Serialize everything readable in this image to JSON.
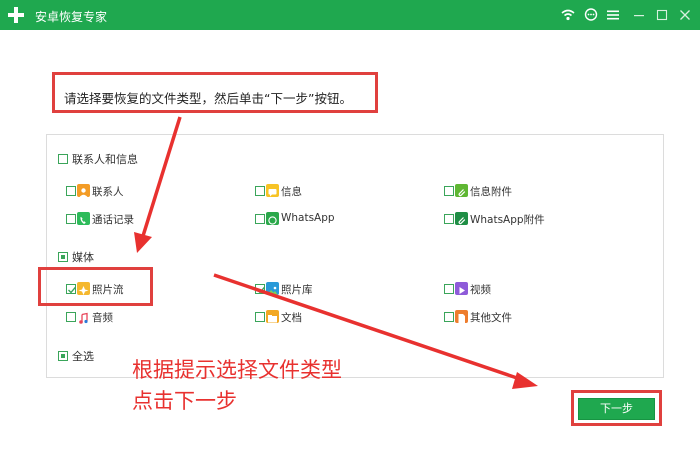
{
  "titlebar": {
    "title": "安卓恢复专家",
    "bg_color": "#1fa84f",
    "icons": [
      "wifi-icon",
      "chat-icon",
      "menu-icon",
      "minimize-icon",
      "maximize-icon",
      "close-icon"
    ]
  },
  "instruction": "请选择要恢复的文件类型，然后单击“下一步”按钮。",
  "groups": {
    "contacts": {
      "label": "联系人和信息",
      "state": "unchecked",
      "items": [
        {
          "label": "联系人",
          "icon": "contact-icon",
          "checked": false
        },
        {
          "label": "信息",
          "icon": "message-icon",
          "checked": false
        },
        {
          "label": "信息附件",
          "icon": "attachment-icon",
          "checked": false
        },
        {
          "label": "通话记录",
          "icon": "call-log-icon",
          "checked": false
        },
        {
          "label": "WhatsApp",
          "icon": "whatsapp-icon",
          "checked": false
        },
        {
          "label": "WhatsApp附件",
          "icon": "whatsapp-attachment-icon",
          "checked": false
        }
      ]
    },
    "media": {
      "label": "媒体",
      "state": "partial",
      "items": [
        {
          "label": "照片流",
          "icon": "photo-stream-icon",
          "checked": true
        },
        {
          "label": "照片库",
          "icon": "photo-library-icon",
          "checked": true
        },
        {
          "label": "视频",
          "icon": "video-icon",
          "checked": false
        },
        {
          "label": "音频",
          "icon": "audio-icon",
          "checked": false
        },
        {
          "label": "文档",
          "icon": "document-icon",
          "checked": false
        },
        {
          "label": "其他文件",
          "icon": "other-files-icon",
          "checked": false
        }
      ]
    },
    "select_all": {
      "label": "全选",
      "state": "partial"
    }
  },
  "callout": {
    "line1": "根据提示选择文件类型",
    "line2": "点击下一步",
    "color": "#e8312f"
  },
  "next_button": "下一步",
  "accent_color": "#1fa84f",
  "annotation_color": "#e0403e"
}
